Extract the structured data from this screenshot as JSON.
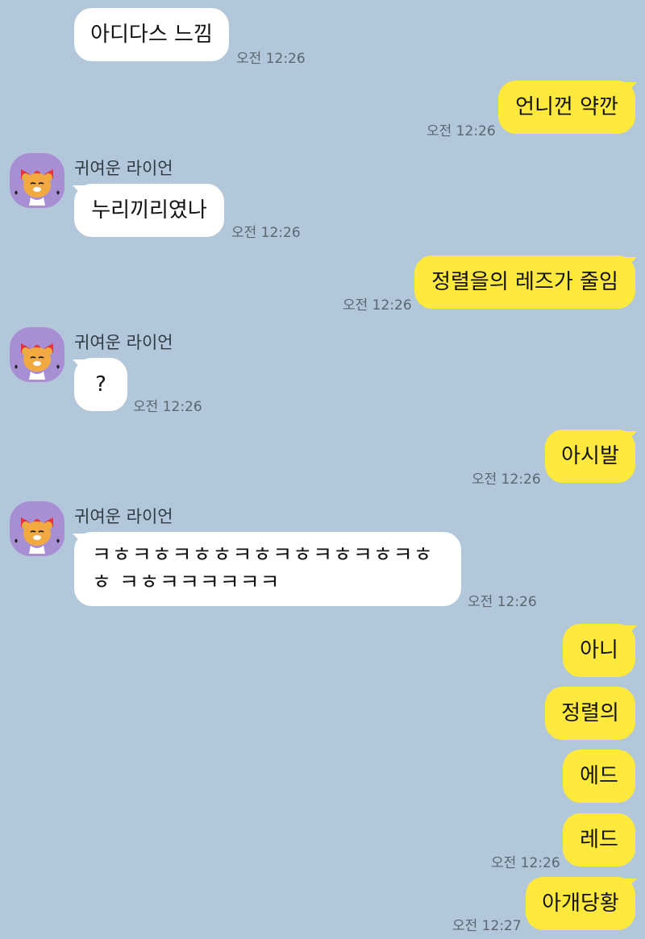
{
  "chat": {
    "partner_name": "귀여운 라이언",
    "partner_avatar_icon": "ryan-character-icon",
    "colors": {
      "background": "#b2c7d9",
      "incoming_bubble": "#ffffff",
      "outgoing_bubble": "#fee93c"
    },
    "messages": [
      {
        "direction": "in",
        "text": "아디다스 느낌",
        "time": "오전 12:26"
      },
      {
        "direction": "out",
        "text": "언니껀 약깐",
        "time": "오전 12:26"
      },
      {
        "direction": "in",
        "sender": "귀여운 라이언",
        "text": "누리끼리였나",
        "time": "오전 12:26"
      },
      {
        "direction": "out",
        "text": "정렬을의 레즈가 줄임",
        "time": "오전 12:26"
      },
      {
        "direction": "in",
        "sender": "귀여운 라이언",
        "text": "?",
        "time": "오전 12:26"
      },
      {
        "direction": "out",
        "text": "아시발",
        "time": "오전 12:26"
      },
      {
        "direction": "in",
        "sender": "귀여운 라이언",
        "text": "ㅋㅎㅋㅎㅋㅎㅎㅋㅎㅋㅎㅋㅎㅋㅎㅋㅎㅎ ㅋㅎㅋㅋㅋㅋㅋㅋ",
        "time": "오전 12:26"
      },
      {
        "direction": "out",
        "text": "아니"
      },
      {
        "direction": "out",
        "text": "정렬의"
      },
      {
        "direction": "out",
        "text": "에드"
      },
      {
        "direction": "out",
        "text": "레드",
        "time": "오전 12:26"
      },
      {
        "direction": "out",
        "text": "아개당황",
        "time": "오전 12:27"
      }
    ]
  }
}
